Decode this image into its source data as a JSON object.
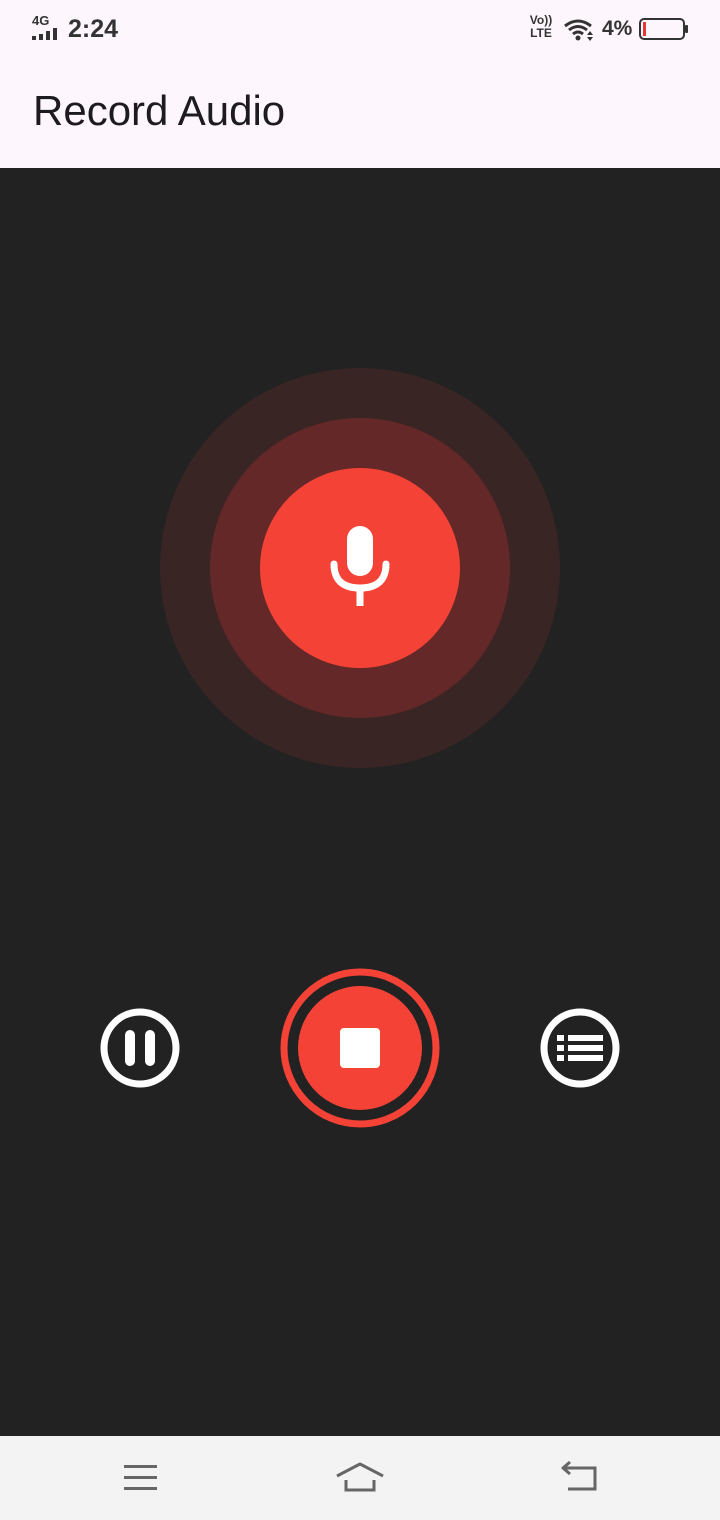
{
  "status_bar": {
    "network_type": "4G",
    "time": "2:24",
    "volte_top": "Vo))",
    "volte_bottom": "LTE",
    "battery_percent": "4%"
  },
  "app_bar": {
    "title": "Record Audio"
  },
  "recorder": {
    "state": "recording",
    "mic_icon": "microphone-icon",
    "pause_icon": "pause-icon",
    "stop_icon": "stop-icon",
    "list_icon": "list-icon"
  },
  "nav_bar": {
    "menu_icon": "menu-icon",
    "home_icon": "home-icon",
    "back_icon": "back-icon"
  },
  "colors": {
    "accent": "#f44336",
    "background": "#222222",
    "app_bar": "#fdf7fd",
    "pulse_outer": "#3a2525",
    "pulse_mid": "#652828"
  }
}
